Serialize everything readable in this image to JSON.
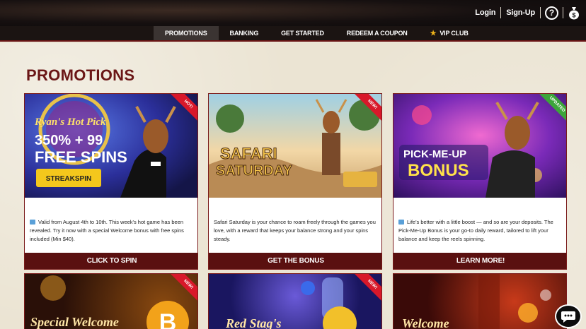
{
  "header": {
    "login": "Login",
    "signup": "Sign-Up",
    "help_icon": "question-circle-icon",
    "bag_icon": "money-bag-icon"
  },
  "nav": [
    {
      "label": "PROMOTIONS",
      "active": true
    },
    {
      "label": "BANKING",
      "active": false
    },
    {
      "label": "GET STARTED",
      "active": false
    },
    {
      "label": "REDEEM A COUPON",
      "active": false
    },
    {
      "label": "VIP CLUB",
      "active": false,
      "icon": "star-icon"
    }
  ],
  "page": {
    "title": "PROMOTIONS"
  },
  "promotions": [
    {
      "banner_lines": [
        "Ryan's Hot Pick",
        "350% + 99",
        "FREE SPINS"
      ],
      "code": "STREAKSPIN",
      "ribbon": "HOT!",
      "description": "Valid from August 4th to 10th. This week's hot game has been revealed. Try it now with a special Welcome bonus with free spins included (Min $40).",
      "button": "CLICK TO SPIN"
    },
    {
      "banner_lines": [
        "SAFARI",
        "SATURDAY"
      ],
      "ribbon": "NEW!",
      "description": "Safari Saturday is your chance to roam freely through the games you love, with a reward that keeps your balance strong and your spins steady.",
      "button": "GET THE BONUS"
    },
    {
      "banner_lines": [
        "PICK-ME-UP",
        "BONUS"
      ],
      "ribbon": "UPDATED",
      "description": "Life's better with a little boost — and so are your deposits. The Pick-Me-Up Bonus is your go-to daily reward, tailored to lift your balance and keep the reels spinning.",
      "button": "LEARN MORE!"
    }
  ],
  "promotions_row2": [
    {
      "banner_text": "Special Welcome",
      "ribbon": "NEW!"
    },
    {
      "banner_text": "Red Stag's",
      "ribbon": "NEW!"
    },
    {
      "banner_text": "Welcome"
    }
  ],
  "chat": {
    "icon": "chat-bubble-icon"
  },
  "colors": {
    "brand_dark_red": "#5a1010",
    "title_red": "#6a1616",
    "ribbon_red": "#d8182a",
    "ribbon_green": "#3ca53a",
    "vip_star": "#f0b41a"
  }
}
